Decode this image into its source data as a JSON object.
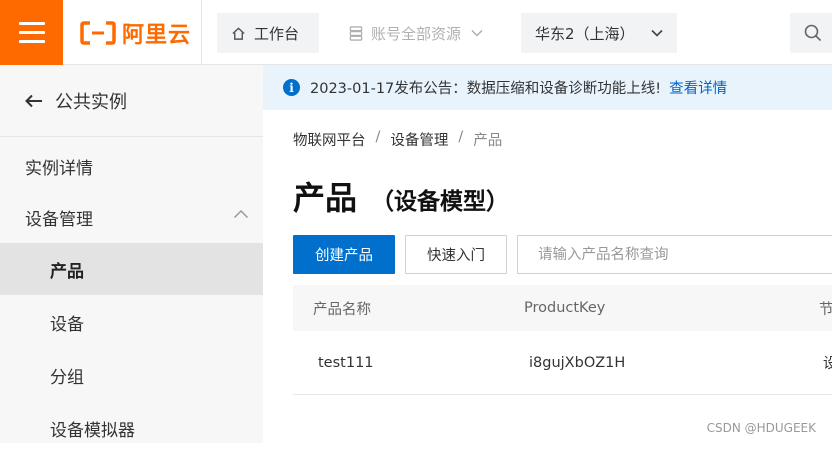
{
  "header": {
    "brand": "阿里云",
    "workbench_label": "工作台",
    "resources_label": "账号全部资源",
    "region_label": "华东2（上海）"
  },
  "sidebar": {
    "back_label": "公共实例",
    "items": [
      {
        "label": "实例详情"
      },
      {
        "label": "设备管理"
      },
      {
        "label": "产品"
      },
      {
        "label": "设备"
      },
      {
        "label": "分组"
      },
      {
        "label": "设备模拟器"
      }
    ]
  },
  "notice": {
    "text": "2023-01-17发布公告：数据压缩和设备诊断功能上线!",
    "link": "查看详情"
  },
  "breadcrumb": [
    "物联网平台",
    "设备管理",
    "产品"
  ],
  "page": {
    "title": "产品",
    "subtitle": "（设备模型）"
  },
  "toolbar": {
    "create_label": "创建产品",
    "quickstart_label": "快速入门",
    "search_placeholder": "请输入产品名称查询"
  },
  "table": {
    "headers": [
      "产品名称",
      "ProductKey",
      "节"
    ],
    "rows": [
      [
        "test111",
        "i8gujXbOZ1H",
        "设"
      ]
    ]
  },
  "watermark": "CSDN @HDUGEEK",
  "colors": {
    "brand_orange": "#ff6a00",
    "primary_blue": "#0070cc",
    "link_blue": "#0064c8",
    "notice_bg": "#e8f3fb"
  }
}
